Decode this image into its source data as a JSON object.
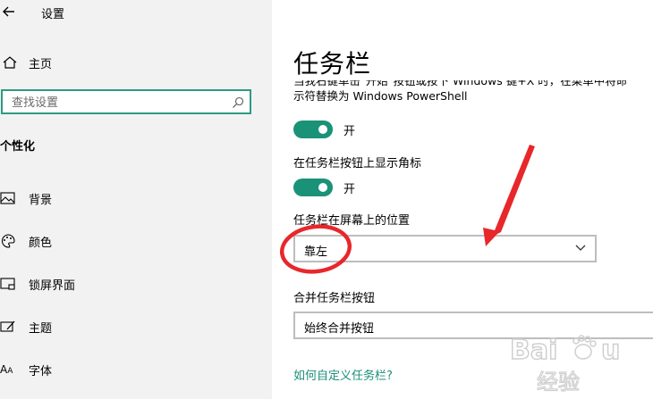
{
  "window": {
    "title": "设置"
  },
  "sidebar": {
    "home_label": "主页",
    "search_placeholder": "查找设置",
    "section_title": "个性化",
    "items": [
      {
        "label": "背景",
        "icon": "picture-icon"
      },
      {
        "label": "颜色",
        "icon": "palette-icon"
      },
      {
        "label": "锁屏界面",
        "icon": "lock-screen-icon"
      },
      {
        "label": "主题",
        "icon": "theme-icon"
      },
      {
        "label": "字体",
        "icon": "font-icon"
      }
    ]
  },
  "main": {
    "title": "任务栏",
    "desc_line1": "当我右键单击\"开始\"按钮或按下 Windows 键+X 时，在菜单中将命",
    "desc_line2": "示符替换为 Windows PowerShell",
    "toggle1_state": "开",
    "setting2_label": "在任务栏按钮上显示角标",
    "toggle2_state": "开",
    "position_label": "任务栏在屏幕上的位置",
    "position_value": "靠左",
    "combine_label": "合并任务栏按钮",
    "combine_value": "始终合并按钮",
    "help_link": "如何自定义任务栏?"
  },
  "colors": {
    "accent": "#1a9278",
    "annotation": "#e8272b",
    "sidebar_bg": "#f2f2f2"
  },
  "watermark": {
    "brand_text": "Baidu 经验"
  }
}
